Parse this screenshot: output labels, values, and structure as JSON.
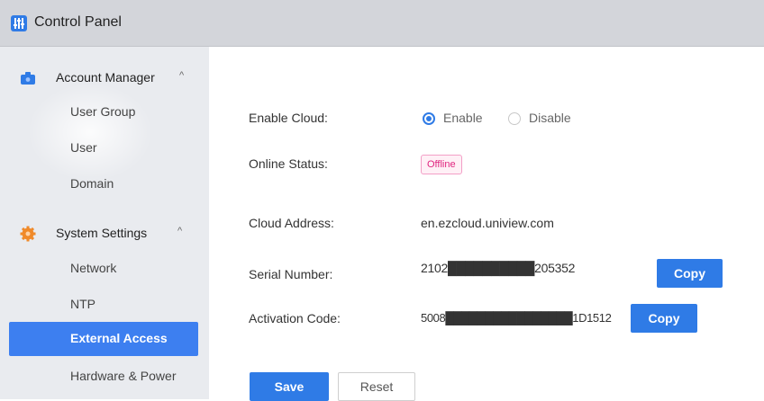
{
  "window": {
    "title": "Control Panel",
    "app_icon": "control-panel-icon"
  },
  "sidebar": {
    "groups": [
      {
        "label": "Account Manager",
        "icon": "account-manager-icon",
        "expanded": true,
        "items": [
          {
            "label": "User Group"
          },
          {
            "label": "User"
          },
          {
            "label": "Domain"
          }
        ]
      },
      {
        "label": "System Settings",
        "icon": "system-settings-gear-icon",
        "expanded": true,
        "items": [
          {
            "label": "Network"
          },
          {
            "label": "NTP"
          },
          {
            "label": "External Access",
            "active": true
          },
          {
            "label": "Hardware & Power"
          }
        ]
      }
    ],
    "caret_glyph": "^"
  },
  "form": {
    "enable_cloud": {
      "label": "Enable Cloud:",
      "options": [
        "Enable",
        "Disable"
      ],
      "selected": "Enable"
    },
    "online_status": {
      "label": "Online Status:",
      "value": "Offline",
      "badge_color": "#e0257f"
    },
    "cloud_address": {
      "label": "Cloud Address:",
      "value": "en.ezcloud.uniview.com"
    },
    "serial_number": {
      "label": "Serial Number:",
      "value": "2102██████████205352",
      "copy_label": "Copy"
    },
    "activation_code": {
      "label": "Activation Code:",
      "value": "5008████████████████1D1512",
      "copy_label": "Copy"
    }
  },
  "actions": {
    "save_label": "Save",
    "reset_label": "Reset"
  },
  "colors": {
    "accent": "#2f7be6",
    "active_nav": "#3d7ff0",
    "titlebar": "#d3d5da",
    "sidebar": "#e9ebef"
  }
}
